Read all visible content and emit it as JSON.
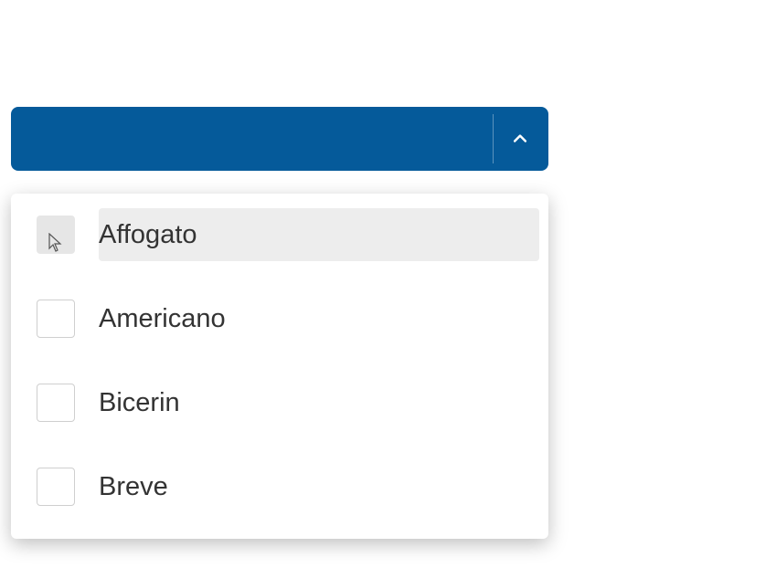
{
  "dropdown": {
    "expanded": true,
    "selected_label": "",
    "options": [
      {
        "label": "Affogato",
        "highlighted": true,
        "checkbox_hovered": true
      },
      {
        "label": "Americano",
        "highlighted": false,
        "checkbox_hovered": false
      },
      {
        "label": "Bicerin",
        "highlighted": false,
        "checkbox_hovered": false
      },
      {
        "label": "Breve",
        "highlighted": false,
        "checkbox_hovered": false
      }
    ]
  },
  "colors": {
    "primary": "#055a9a",
    "highlight": "#ededed"
  }
}
